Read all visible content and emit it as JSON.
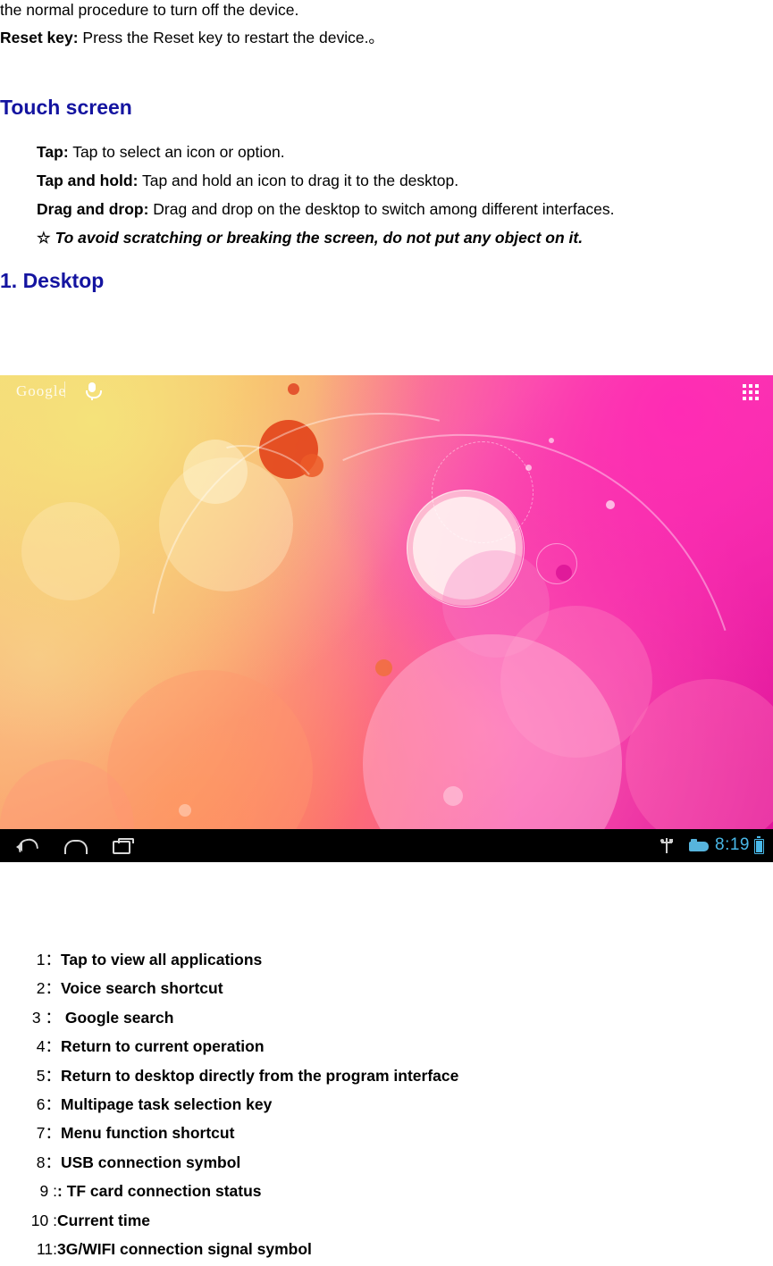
{
  "document": {
    "top_lines": [
      {
        "plain": "the normal procedure to turn off the device."
      },
      {
        "bold": "Reset key:",
        "plain": " Press the Reset key to restart the device.。"
      }
    ],
    "headings": {
      "touch_screen": "Touch screen",
      "desktop": "1. Desktop"
    },
    "touch_items": [
      {
        "bold": "Tap:",
        "plain": " Tap to select an icon or option."
      },
      {
        "bold": "Tap and hold:",
        "plain": " Tap and hold an icon to drag it to the desktop."
      },
      {
        "bold": "Drag and drop:",
        "plain": " Drag and drop on the desktop to switch among different interfaces."
      }
    ],
    "note": {
      "icon": "☆",
      "text": " To avoid scratching or breaking the screen, do not put any object on it."
    }
  },
  "screenshot": {
    "status_bar": {
      "google_logo": "Google",
      "mic_icon": "microphone-icon",
      "apps_icon": "apps-grid-icon"
    },
    "nav_bar": {
      "back_icon": "back-arrow-icon",
      "home_icon": "home-icon",
      "recent_icon": "recent-apps-icon",
      "usb_icon": "usb-icon",
      "tf_icon": "tf-card-icon",
      "clock": "8:19",
      "battery_icon": "battery-icon"
    }
  },
  "legend": {
    "items": [
      {
        "num": "1：",
        "label": "Tap to view all applications"
      },
      {
        "num": "2：",
        "label": "Voice search shortcut"
      },
      {
        "num": "3 ：",
        "label": " Google search"
      },
      {
        "num": "4：",
        "label": "Return to current operation"
      },
      {
        "num": "5：",
        "label": "Return to desktop directly from the program interface"
      },
      {
        "num": "6：",
        "label": "Multipage task selection key"
      },
      {
        "num": "7：",
        "label": "Menu function shortcut"
      },
      {
        "num": "8：",
        "label": "USB connection symbol"
      },
      {
        "num": "9 : ",
        "label": ": TF card connection status"
      },
      {
        "num": "10 : ",
        "label": "Current time"
      },
      {
        "num": "11: ",
        "label": "3G/WIFI connection signal symbol"
      }
    ]
  }
}
